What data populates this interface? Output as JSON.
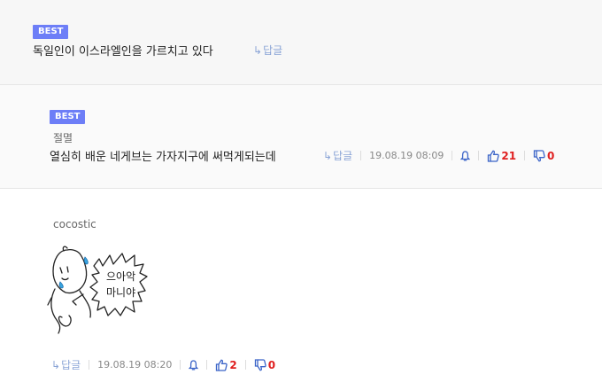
{
  "comments": [
    {
      "badge": "BEST",
      "text": "독일인이 이스라엘인을 가르치고 있다",
      "reply_label": "답글"
    },
    {
      "badge": "BEST",
      "author": "절멸",
      "text": "열심히 배운 네게브는 가자지구에 써먹게되는데",
      "reply_label": "답글",
      "timestamp": "19.08.19 08:09",
      "upvotes": "21",
      "downvotes": "0"
    },
    {
      "author": "cocostic",
      "image_text": [
        "으아악",
        "마니야"
      ],
      "reply_label": "답글",
      "timestamp": "19.08.19 08:20",
      "upvotes": "2",
      "downvotes": "0"
    }
  ],
  "colors": {
    "badge": "#6d7ef7",
    "reply": "#8aa4d6",
    "vote_icon": "#3b64c8",
    "count": "#e02020"
  },
  "icons": [
    "reply-arrow-icon",
    "report-bell-icon",
    "thumbs-up-icon",
    "thumbs-down-icon"
  ]
}
